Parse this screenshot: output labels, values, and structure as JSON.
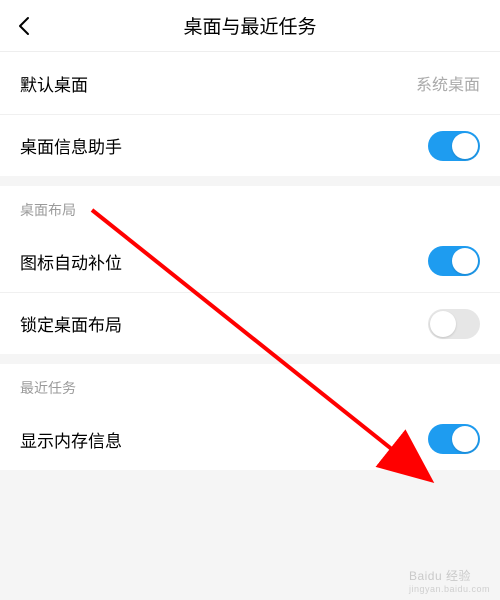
{
  "header": {
    "title": "桌面与最近任务"
  },
  "group1": {
    "items": [
      {
        "label": "默认桌面",
        "value": "系统桌面",
        "type": "value"
      },
      {
        "label": "桌面信息助手",
        "type": "toggle",
        "on": true
      }
    ]
  },
  "section1": {
    "title": "桌面布局",
    "items": [
      {
        "label": "图标自动补位",
        "type": "toggle",
        "on": true
      },
      {
        "label": "锁定桌面布局",
        "type": "toggle",
        "on": false
      }
    ]
  },
  "section2": {
    "title": "最近任务",
    "items": [
      {
        "label": "显示内存信息",
        "type": "toggle",
        "on": true
      }
    ]
  },
  "watermark": {
    "brand": "Baidu 经验",
    "url": "jingyan.baidu.com"
  },
  "annotation": {
    "arrow_color": "#ff0000"
  }
}
